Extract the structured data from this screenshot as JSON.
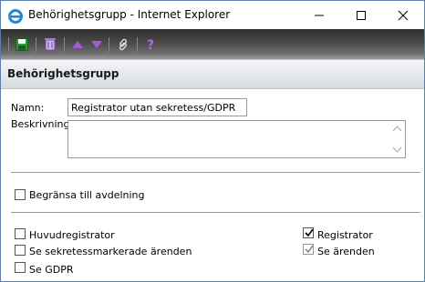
{
  "window": {
    "title": "Behörighetsgrupp - Internet Explorer",
    "icon": "ie-icon"
  },
  "toolbar": {
    "buttons": [
      "save-icon",
      "delete-icon",
      "move-up-icon",
      "move-down-icon",
      "link-icon",
      "help-icon"
    ]
  },
  "section": {
    "title": "Behörighetsgrupp"
  },
  "form": {
    "name_label": "Namn:",
    "name_value": "Registrator utan sekretess/GDPR",
    "description_label": "Beskrivning:",
    "description_value": ""
  },
  "options": {
    "limit_department": {
      "label": "Begränsa till avdelning",
      "checked": false
    },
    "left": [
      {
        "label": "Huvudregistrator",
        "checked": false
      },
      {
        "label": "Se sekretessmarkerade ärenden",
        "checked": false
      },
      {
        "label": "Se GDPR",
        "checked": false
      }
    ],
    "right": [
      {
        "label": "Registrator",
        "checked": true,
        "disabled": false
      },
      {
        "label": "Se ärenden",
        "checked": true,
        "disabled": true
      }
    ]
  },
  "colors": {
    "toolbar_dark": "#2f2f2f",
    "header_bg": "#d6dbe2",
    "accent_purple": "#7a3fa8"
  }
}
